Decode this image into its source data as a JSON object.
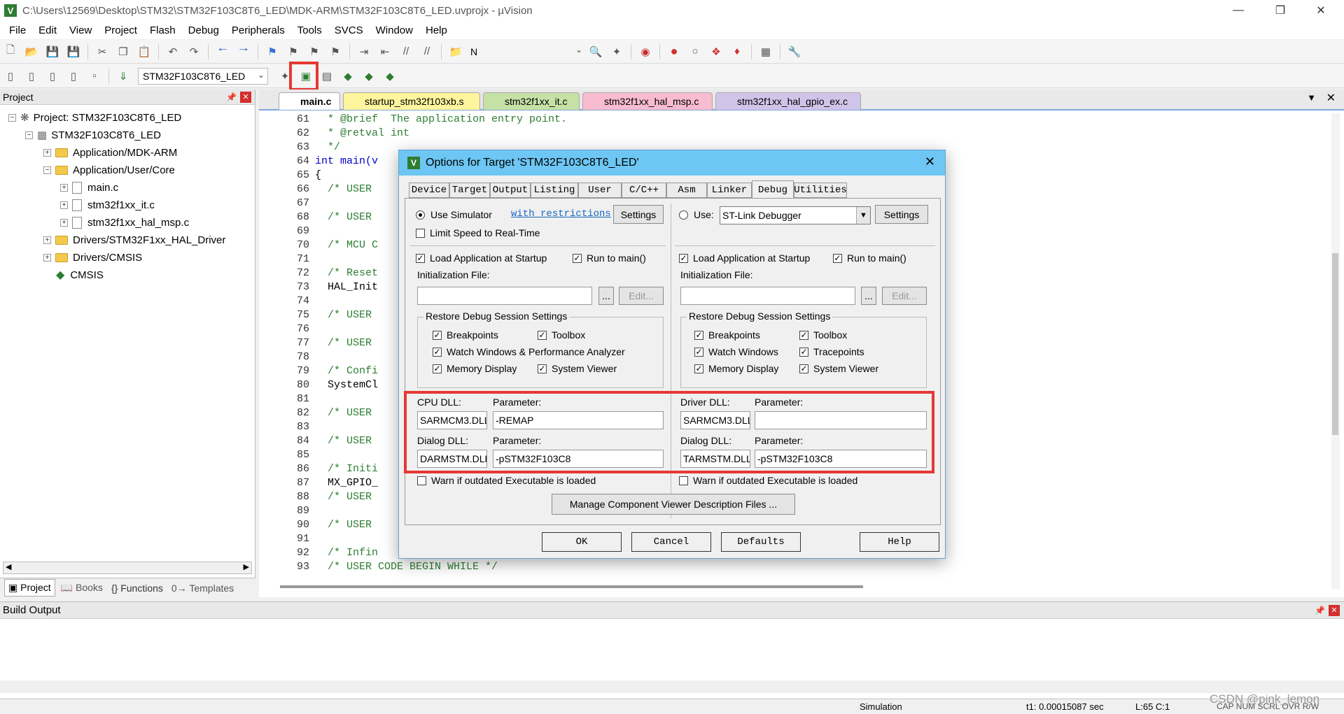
{
  "window": {
    "title": "C:\\Users\\12569\\Desktop\\STM32\\STM32F103C8T6_LED\\MDK-ARM\\STM32F103C8T6_LED.uvprojx - µVision"
  },
  "menu": [
    "File",
    "Edit",
    "View",
    "Project",
    "Flash",
    "Debug",
    "Peripherals",
    "Tools",
    "SVCS",
    "Window",
    "Help"
  ],
  "toolbar": {
    "find_value": "N",
    "target_name": "STM32F103C8T6_LED"
  },
  "project_panel": {
    "title": "Project",
    "tree": [
      {
        "label": "Project: STM32F103C8T6_LED"
      },
      {
        "label": "STM32F103C8T6_LED"
      },
      {
        "label": "Application/MDK-ARM"
      },
      {
        "label": "Application/User/Core"
      },
      {
        "label": "main.c"
      },
      {
        "label": "stm32f1xx_it.c"
      },
      {
        "label": "stm32f1xx_hal_msp.c"
      },
      {
        "label": "Drivers/STM32F1xx_HAL_Driver"
      },
      {
        "label": "Drivers/CMSIS"
      },
      {
        "label": "CMSIS"
      }
    ],
    "bottom_tabs": [
      "Project",
      "Books",
      "Functions",
      "Templates"
    ]
  },
  "editor_tabs": [
    {
      "label": "main.c",
      "color": "#ffffff"
    },
    {
      "label": "startup_stm32f103xb.s",
      "color": "#fff59d"
    },
    {
      "label": "stm32f1xx_it.c",
      "color": "#c5e1a5"
    },
    {
      "label": "stm32f1xx_hal_msp.c",
      "color": "#f8bbd0"
    },
    {
      "label": "stm32f1xx_hal_gpio_ex.c",
      "color": "#d1c4e9"
    }
  ],
  "code": [
    {
      "n": "61",
      "t": "  * @brief  The application entry point."
    },
    {
      "n": "62",
      "t": "  * @retval int"
    },
    {
      "n": "63",
      "t": "  */"
    },
    {
      "n": "64",
      "t": "int main(v"
    },
    {
      "n": "65",
      "t": "{"
    },
    {
      "n": "66",
      "t": "  /* USER "
    },
    {
      "n": "67",
      "t": ""
    },
    {
      "n": "68",
      "t": "  /* USER "
    },
    {
      "n": "69",
      "t": ""
    },
    {
      "n": "70",
      "t": "  /* MCU C"
    },
    {
      "n": "71",
      "t": ""
    },
    {
      "n": "72",
      "t": "  /* Reset"
    },
    {
      "n": "73",
      "t": "  HAL_Init"
    },
    {
      "n": "74",
      "t": ""
    },
    {
      "n": "75",
      "t": "  /* USER "
    },
    {
      "n": "76",
      "t": ""
    },
    {
      "n": "77",
      "t": "  /* USER "
    },
    {
      "n": "78",
      "t": ""
    },
    {
      "n": "79",
      "t": "  /* Confi"
    },
    {
      "n": "80",
      "t": "  SystemCl"
    },
    {
      "n": "81",
      "t": ""
    },
    {
      "n": "82",
      "t": "  /* USER "
    },
    {
      "n": "83",
      "t": ""
    },
    {
      "n": "84",
      "t": "  /* USER "
    },
    {
      "n": "85",
      "t": ""
    },
    {
      "n": "86",
      "t": "  /* Initi"
    },
    {
      "n": "87",
      "t": "  MX_GPIO_"
    },
    {
      "n": "88",
      "t": "  /* USER "
    },
    {
      "n": "89",
      "t": ""
    },
    {
      "n": "90",
      "t": "  /* USER "
    },
    {
      "n": "91",
      "t": ""
    },
    {
      "n": "92",
      "t": "  /* Infin"
    },
    {
      "n": "93",
      "t": "  /* USER CODE BEGIN WHILE */"
    }
  ],
  "dialog": {
    "title": "Options for Target 'STM32F103C8T6_LED'",
    "tabs": [
      "Device",
      "Target",
      "Output",
      "Listing",
      "User",
      "C/C++",
      "Asm",
      "Linker",
      "Debug",
      "Utilities"
    ],
    "active_tab": "Debug",
    "left": {
      "use_simulator": "Use Simulator",
      "restrictions_link": "with restrictions",
      "settings": "Settings",
      "limit_speed": "Limit Speed to Real-Time",
      "load_app": "Load Application at Startup",
      "run_to_main": "Run to main()",
      "init_file": "Initialization File:",
      "browse": "...",
      "edit": "Edit...",
      "restore_group": "Restore Debug Session Settings",
      "breakpoints": "Breakpoints",
      "toolbox": "Toolbox",
      "watch": "Watch Windows & Performance Analyzer",
      "memory": "Memory Display",
      "sysviewer": "System Viewer",
      "cpu_dll_label": "CPU DLL:",
      "cpu_param_label": "Parameter:",
      "cpu_dll": "SARMCM3.DLL",
      "cpu_param": "-REMAP",
      "dialog_dll_label": "Dialog DLL:",
      "dialog_param_label": "Parameter:",
      "dialog_dll": "DARMSTM.DLL",
      "dialog_param": "-pSTM32F103C8",
      "warn": "Warn if outdated Executable is loaded"
    },
    "right": {
      "use": "Use:",
      "debugger": "ST-Link Debugger",
      "settings": "Settings",
      "load_app": "Load Application at Startup",
      "run_to_main": "Run to main()",
      "init_file": "Initialization File:",
      "browse": "...",
      "edit": "Edit...",
      "restore_group": "Restore Debug Session Settings",
      "breakpoints": "Breakpoints",
      "toolbox": "Toolbox",
      "watch": "Watch Windows",
      "tracepoints": "Tracepoints",
      "memory": "Memory Display",
      "sysviewer": "System Viewer",
      "driver_dll_label": "Driver DLL:",
      "driver_param_label": "Parameter:",
      "driver_dll": "SARMCM3.DLL",
      "driver_param": "",
      "dialog_dll_label": "Dialog DLL:",
      "dialog_param_label": "Parameter:",
      "dialog_dll": "TARMSTM.DLL",
      "dialog_param": "-pSTM32F103C8",
      "warn": "Warn if outdated Executable is loaded"
    },
    "manage_btn": "Manage Component Viewer Description Files ...",
    "ok": "OK",
    "cancel": "Cancel",
    "defaults": "Defaults",
    "help": "Help"
  },
  "build_output": {
    "title": "Build Output"
  },
  "status": {
    "mode": "Simulation",
    "time": "t1: 0.00015087 sec",
    "pos": "L:65 C:1",
    "caps": "CAP  NUM  SCRL  OVR  R/W",
    "watermark": "CSDN @pink_lemon"
  }
}
